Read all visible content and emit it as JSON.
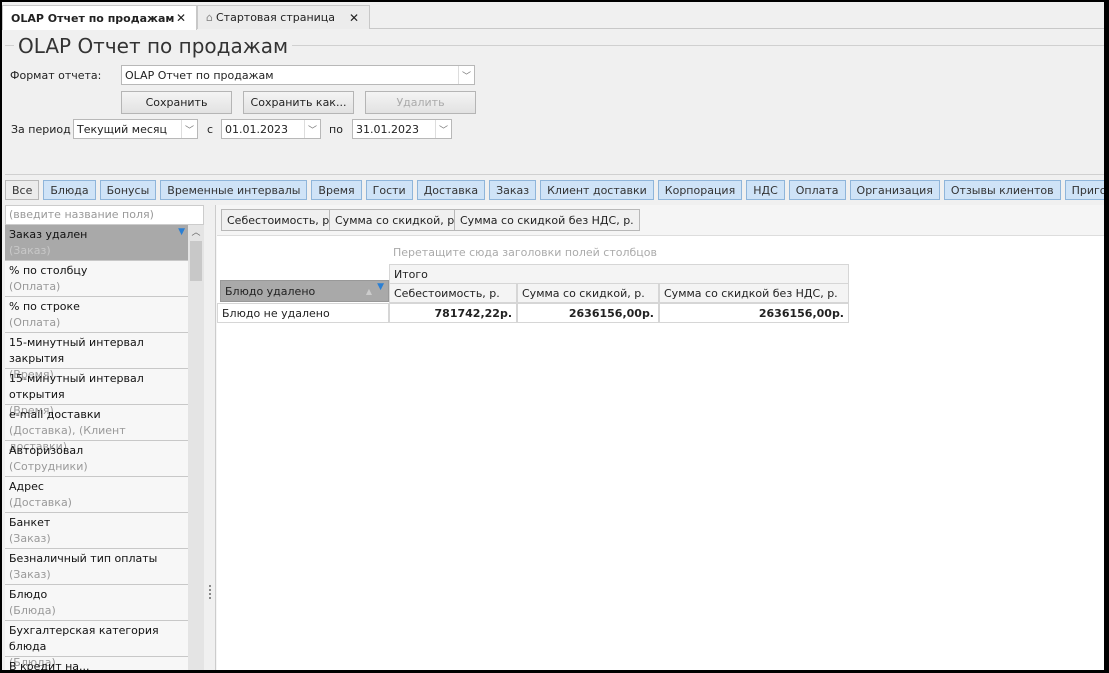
{
  "tabs": [
    {
      "label": "OLAP Отчет по продажам",
      "close": "✕"
    },
    {
      "label": "Стартовая страница",
      "icon": "home-icon",
      "close": "✕"
    }
  ],
  "title": "OLAP Отчет по продажам",
  "form": {
    "format_label": "Формат отчета:",
    "format_value": "OLAP Отчет по продажам",
    "save": "Сохранить",
    "save_as": "Сохранить как...",
    "delete": "Удалить",
    "period_label": "За период",
    "period_value": "Текущий месяц",
    "from_label": "с",
    "from_value": "01.01.2023",
    "to_label": "по",
    "to_value": "31.01.2023"
  },
  "filters": [
    "Все",
    "Блюда",
    "Бонусы",
    "Временные интервалы",
    "Время",
    "Гости",
    "Доставка",
    "Заказ",
    "Клиент доставки",
    "Корпорация",
    "НДС",
    "Оплата",
    "Организация",
    "Отзывы клиентов",
    "Приготовление"
  ],
  "search_placeholder": "(введите название поля)",
  "fields": [
    {
      "name": "Заказ удален",
      "cat": "(Заказ)"
    },
    {
      "name": "% по столбцу",
      "cat": "(Оплата)"
    },
    {
      "name": "% по строке",
      "cat": "(Оплата)"
    },
    {
      "name": "15-минутный интервал закрытия",
      "cat": "(Время)"
    },
    {
      "name": "15-минутный интервал открытия",
      "cat": "(Время)"
    },
    {
      "name": "e-mail доставки",
      "cat": "(Доставка), (Клиент доставки)"
    },
    {
      "name": "Авторизовал",
      "cat": "(Сотрудники)"
    },
    {
      "name": "Адрес",
      "cat": "(Доставка)"
    },
    {
      "name": "Банкет",
      "cat": "(Заказ)"
    },
    {
      "name": "Безналичный тип оплаты",
      "cat": "(Заказ)"
    },
    {
      "name": "Блюдо",
      "cat": "(Блюда)"
    },
    {
      "name": "Бухгалтерская категория блюда",
      "cat": "(Блюда)"
    },
    {
      "name": "В кредит на...",
      "cat": ""
    }
  ],
  "data_fields": [
    "Себестоимость, р.",
    "Сумма со скидкой, р.",
    "Сумма со скидкой без НДС, р."
  ],
  "pivot": {
    "hint": "Перетащите сюда заголовки полей столбцов",
    "total": "Итого",
    "row_field": "Блюдо удалено",
    "headers": [
      "Себестоимость, р.",
      "Сумма со скидкой, р.",
      "Сумма со скидкой без НДС, р."
    ],
    "row_label": "Блюдо не удалено",
    "values": [
      "781742,22р.",
      "2636156,00р.",
      "2636156,00р."
    ]
  }
}
